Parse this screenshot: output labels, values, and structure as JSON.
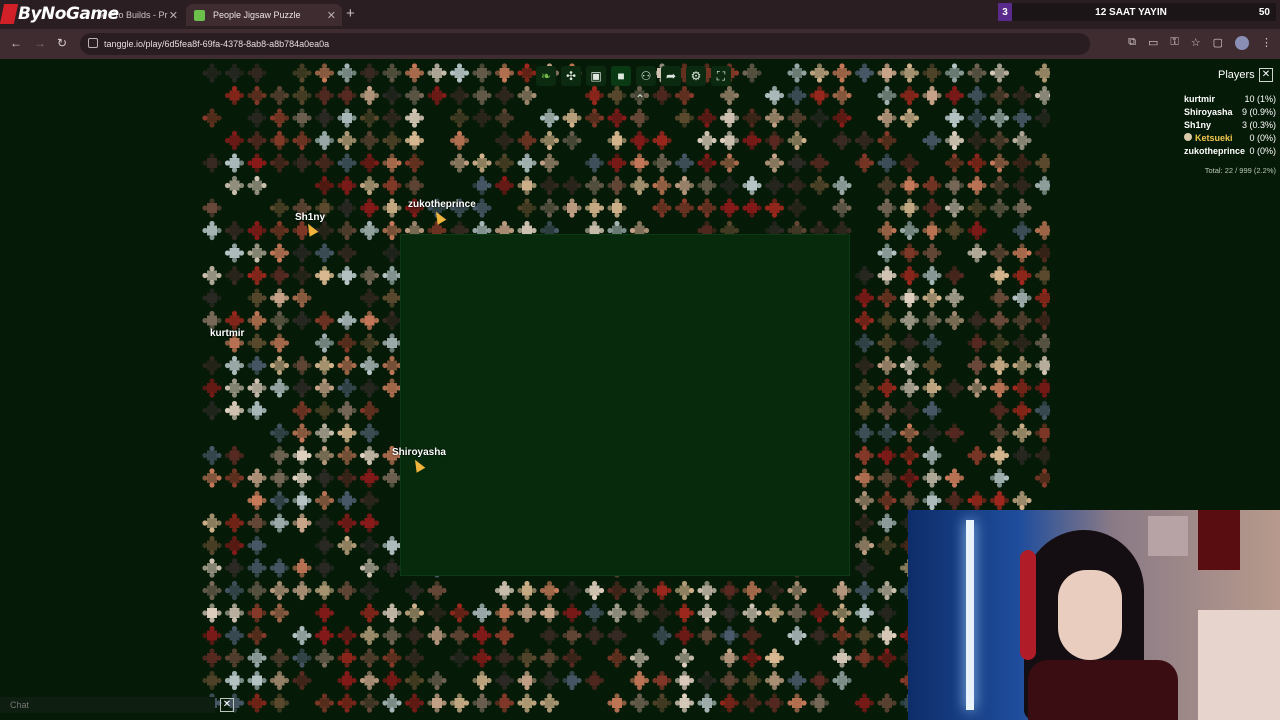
{
  "overlay": {
    "logo_text": "ByNoGame"
  },
  "browser": {
    "tabs": [
      {
        "label": "le Pro Builds - Pr",
        "active": false,
        "favicon_color": "#c0392b"
      },
      {
        "label": "People Jigsaw Puzzle",
        "active": true,
        "favicon_color": "#6bbf4a"
      }
    ],
    "url": "tanggle.io/play/6d5fea8f-69fa-4378-8ab8-a8b784a0ea0a"
  },
  "stream_banner": {
    "left_number": "3",
    "text": "12 SAAT YAYIN",
    "right_number": "50"
  },
  "toolbar": {
    "icons": [
      "leaf-icon",
      "piece-icon",
      "preview-image-icon",
      "background-color-icon",
      "players-icon",
      "share-icon",
      "settings-icon",
      "fullscreen-icon"
    ]
  },
  "cursors": [
    {
      "name": "Sh1ny"
    },
    {
      "name": "zukotheprince"
    },
    {
      "name": "kurtmir"
    },
    {
      "name": "Shiroyasha"
    }
  ],
  "players_panel": {
    "title": "Players",
    "players": [
      {
        "name": "kurtmir",
        "score": "10 (1%)"
      },
      {
        "name": "Shiroyasha",
        "score": "9 (0.9%)"
      },
      {
        "name": "Sh1ny",
        "score": "3 (0.3%)"
      },
      {
        "name": "Ketsueki",
        "score": "0 (0%)",
        "highlight": true
      },
      {
        "name": "zukotheprince",
        "score": "0 (0%)"
      }
    ],
    "total": "Total: 22 / 999 (2.2%)"
  },
  "chat": {
    "placeholder": "Chat"
  },
  "colors": {
    "background": "#061a08",
    "board": "#072a0c",
    "tab_bar": "#2b1e23",
    "banner_accent": "#5b2a8d"
  }
}
